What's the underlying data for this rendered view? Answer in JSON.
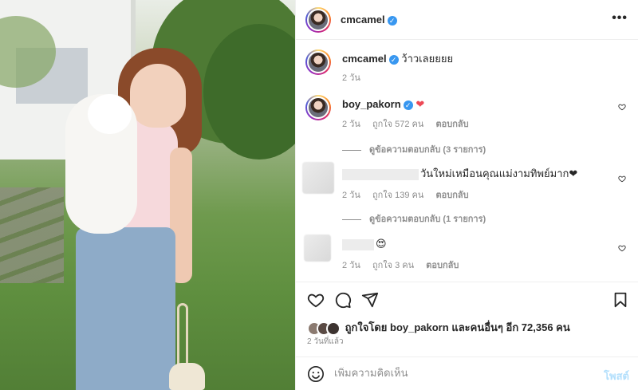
{
  "post": {
    "author": "cmcamel",
    "more_icon_glyph": "•••"
  },
  "caption": {
    "username": "cmcamel",
    "text": "ว้าวเลยยยย",
    "time": "2 วัน"
  },
  "comments": [
    {
      "username": "boy_pakorn",
      "verified": true,
      "text": "❤",
      "time": "2 วัน",
      "likes": "ถูกใจ 572 คน",
      "reply_label": "ตอบกลับ",
      "view_replies": "ดูข้อความตอบกลับ (3 รายการ)"
    },
    {
      "username": "",
      "text": "วันใหม่เหมือนคุณแม่งามทิพย์มาก❤",
      "time": "2 วัน",
      "likes": "ถูกใจ 139 คน",
      "reply_label": "ตอบกลับ",
      "view_replies": "ดูข้อความตอบกลับ (1 รายการ)"
    },
    {
      "username": "",
      "text": "😍",
      "time": "2 วัน",
      "likes": "ถูกใจ 3 คน",
      "reply_label": "ตอบกลับ"
    }
  ],
  "likes_summary": {
    "prefix": "ถูกใจโดย",
    "user": "boy_pakorn",
    "suffix": "และคนอื่นๆ อีก 72,356 คน"
  },
  "posted_date": "2 วันที่แล้ว",
  "add_comment": {
    "placeholder": "เพิ่มความคิดเห็น",
    "post_label": "โพสต์"
  },
  "colors": {
    "verified": "#3897f0",
    "like_red": "#ed4956",
    "post_button": "#b2dffc"
  }
}
